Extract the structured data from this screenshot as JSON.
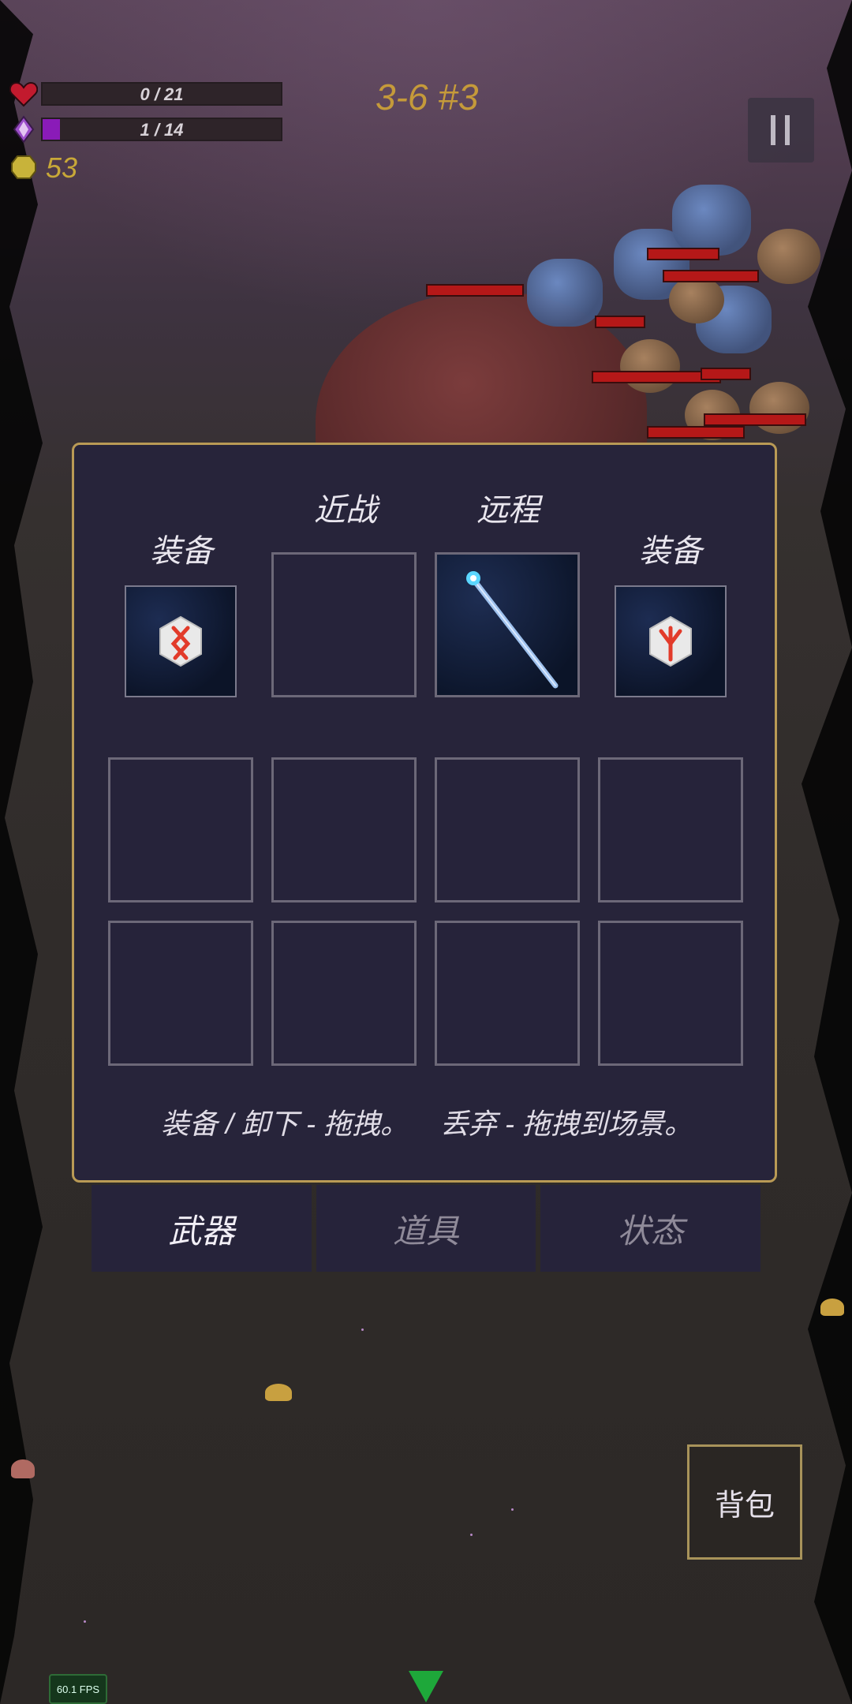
{
  "hud": {
    "health": {
      "text": "0 / 21",
      "current": 0,
      "max": 21,
      "color": "#c21a2e"
    },
    "mana": {
      "text": "1 / 14",
      "current": 1,
      "max": 14,
      "color": "#8a1bb8"
    },
    "gold": "53",
    "stage": "3-6 #3"
  },
  "inventory": {
    "melee_label": "近战",
    "ranged_label": "远程",
    "left_equip_label": "装备",
    "right_equip_label": "装备",
    "ranged_item": "ice-staff",
    "left_rune": "othala-rune",
    "right_rune": "algiz-rune",
    "hint_equip": "装备 / 卸下 - 拖拽。",
    "hint_drop": "丢弃 - 拖拽到场景。"
  },
  "tabs": [
    {
      "label": "武器",
      "active": true
    },
    {
      "label": "道具",
      "active": false
    },
    {
      "label": "状态",
      "active": false
    }
  ],
  "bag_button": "背包",
  "fps": "60.1 FPS",
  "colors": {
    "gold": "#c8a838",
    "panel_border": "#b99a55",
    "panel_bg": "#27243a"
  }
}
